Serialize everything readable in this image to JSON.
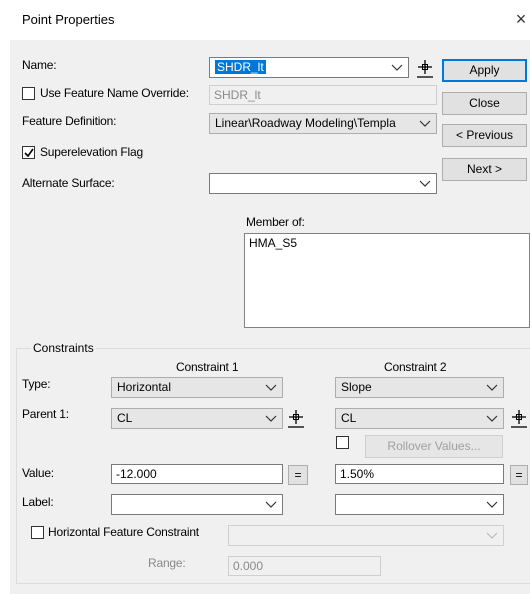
{
  "window": {
    "title": "Point Properties",
    "close_glyph": "×"
  },
  "name": {
    "label": "Name:",
    "value": "SHDR_lt"
  },
  "use_feature_name_override": {
    "label": "Use Feature Name Override:",
    "checked": false,
    "value": "SHDR_lt"
  },
  "feature_definition": {
    "label": "Feature Definition:",
    "value": "Linear\\Roadway Modeling\\Templa"
  },
  "superelevation_flag": {
    "label": "Superelevation Flag",
    "checked": true
  },
  "alternate_surface": {
    "label": "Alternate Surface:",
    "value": ""
  },
  "member_of": {
    "label": "Member of:",
    "items": [
      "HMA_S5"
    ]
  },
  "buttons": {
    "apply": "Apply",
    "close": "Close",
    "previous": "< Previous",
    "next": "Next >"
  },
  "constraints": {
    "group_label": "Constraints",
    "type_label": "Type:",
    "parent1_label": "Parent 1:",
    "value_label": "Value:",
    "label_label": "Label:",
    "constraint1": {
      "header": "Constraint 1",
      "type": "Horizontal",
      "parent": "CL",
      "value": "-12.000",
      "label": ""
    },
    "constraint2": {
      "header": "Constraint 2",
      "type": "Slope",
      "parent": "CL",
      "value": "1.50%",
      "label": ""
    },
    "eq_button": "=",
    "rollover_checked": false,
    "rollover_button": "Rollover Values...",
    "horizontal_feature_constraint": {
      "label": "Horizontal Feature Constraint",
      "checked": false,
      "value": ""
    },
    "range": {
      "label": "Range:",
      "value": "0.000"
    }
  },
  "icons": {
    "pick": "target-pick-icon",
    "chevron": "chevron-down-icon",
    "check": "checkmark-icon"
  }
}
